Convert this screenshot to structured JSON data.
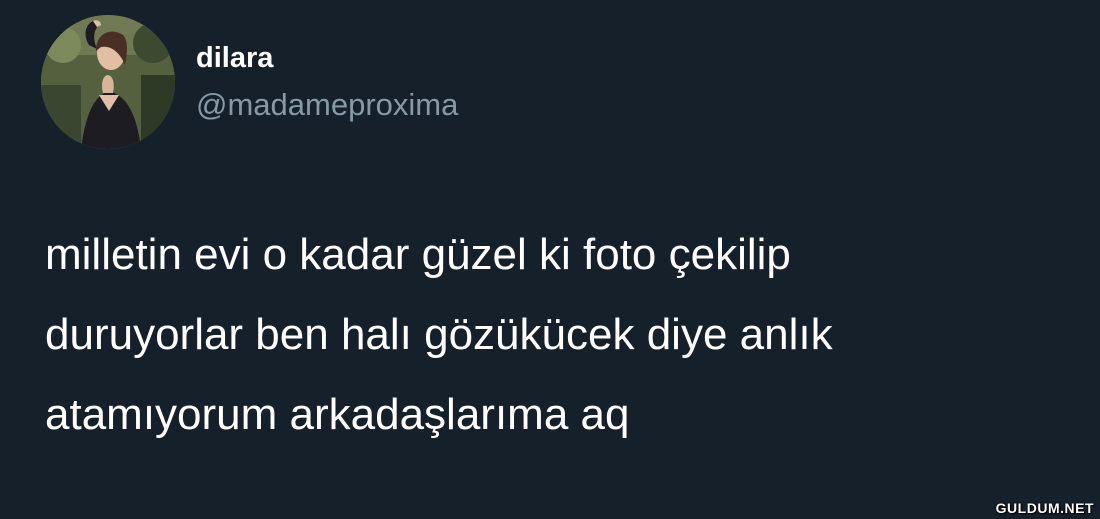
{
  "user": {
    "display_name": "dilara",
    "handle": "@madameproxima"
  },
  "tweet": {
    "lines": [
      "milletin evi o kadar güzel ki foto çekilip",
      "duruyorlar ben halı gözükücek diye anlık",
      "atamıyorum arkadaşlarıma aq"
    ]
  },
  "watermark": "GULDUM.NET",
  "colors": {
    "background": "#15202b",
    "primary_text": "#ffffff",
    "secondary_text": "#8899a6"
  },
  "icons": {
    "avatar": "profile-photo"
  }
}
